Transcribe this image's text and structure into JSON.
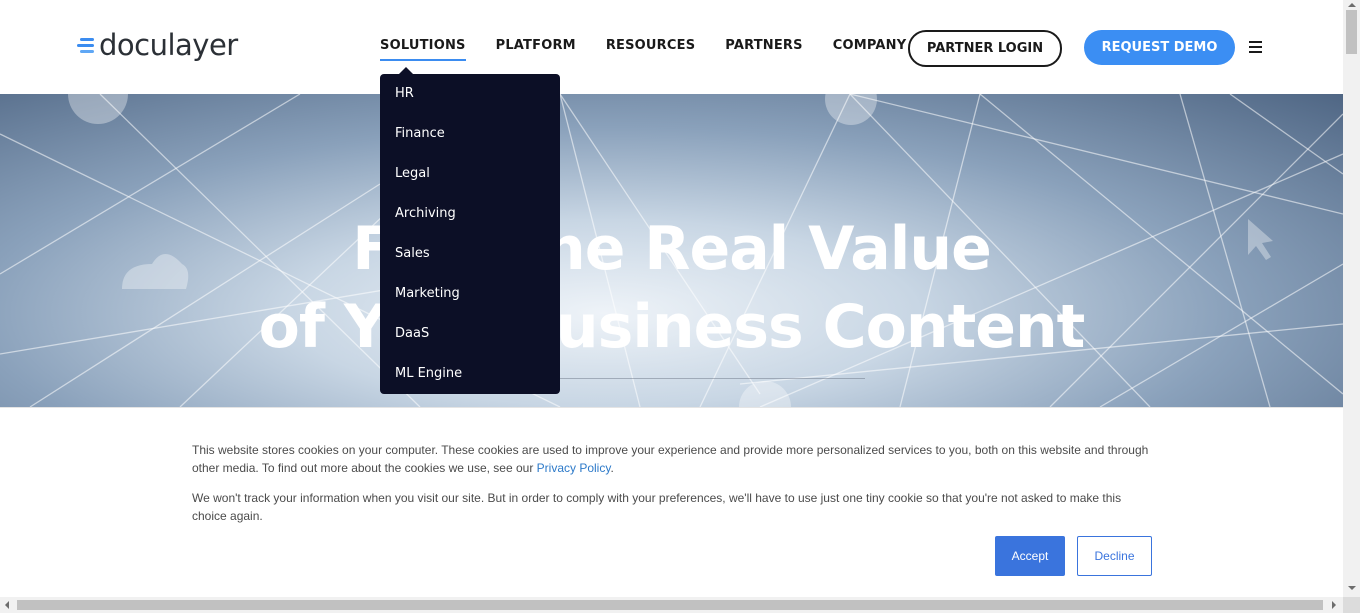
{
  "logo": {
    "text": "doculayer",
    "icon": "stacked-lines-logo-icon"
  },
  "nav": {
    "items": [
      {
        "label": "SOLUTIONS",
        "active": true
      },
      {
        "label": "PLATFORM"
      },
      {
        "label": "RESOURCES"
      },
      {
        "label": "PARTNERS"
      },
      {
        "label": "COMPANY"
      }
    ],
    "partner_login": "PARTNER LOGIN",
    "request_demo": "REQUEST DEMO",
    "menu_icon": "hamburger-icon"
  },
  "solutions_menu": {
    "items": [
      "HR",
      "Finance",
      "Legal",
      "Archiving",
      "Sales",
      "Marketing",
      "DaaS",
      "ML Engine"
    ]
  },
  "hero": {
    "line1": "Find the Real Value",
    "line2": "of Your Business Content"
  },
  "cookie_banner": {
    "text1": "This website stores cookies on your computer. These cookies are used to improve your experience and provide more personalized services to you, both on this website and through other media. To find out more about the cookies we use, see our ",
    "privacy_link": "Privacy Policy",
    "text1_end": ".",
    "text2": "We won't track your information when you visit our site. But in order to comply with your preferences, we'll have to use just one tiny cookie so that you're not asked to make this choice again.",
    "accept": "Accept",
    "decline": "Decline"
  },
  "colors": {
    "accent": "#3b8ef3",
    "dropdown_bg": "#0c0f26",
    "button_primary": "#3a74dd",
    "link": "#2d7ac9"
  }
}
